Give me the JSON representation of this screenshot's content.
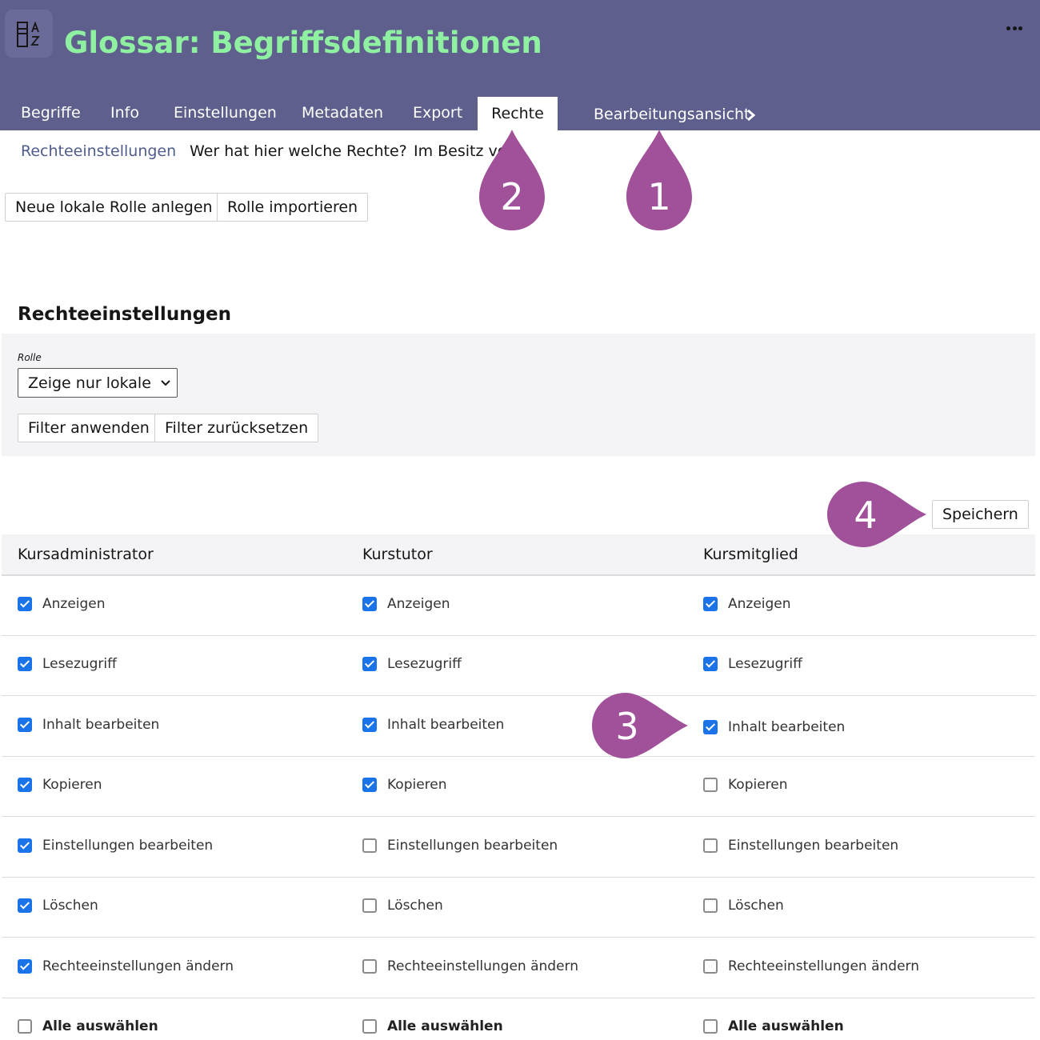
{
  "header": {
    "title": "Glossar: Begriffsdefinitionen",
    "app_icon": "glossary-az-icon",
    "more_icon": "more-dots-icon",
    "tabs": [
      "Begriffe",
      "Info",
      "Einstellungen",
      "Metadaten",
      "Export"
    ],
    "active_tab": "Rechte",
    "edit_view": "Bearbeitungsansicht"
  },
  "subtabs": {
    "active": "Rechteeinstellungen",
    "items": [
      "Wer hat hier welche Rechte?",
      "Im Besitz vo"
    ]
  },
  "actions": {
    "new_role": "Neue lokale Rolle anlegen",
    "import_role": "Rolle importieren"
  },
  "section": {
    "title": "Rechteeinstellungen",
    "filter": {
      "label": "Rolle",
      "select_value": "Zeige nur lokale Rollen",
      "apply": "Filter anwenden",
      "reset": "Filter zurücksetzen"
    },
    "save": "Speichern"
  },
  "table": {
    "columns": [
      "Kursadministrator",
      "Kurstutor",
      "Kursmitglied"
    ],
    "rows": [
      {
        "label": "Anzeigen",
        "checked": [
          true,
          true,
          true
        ]
      },
      {
        "label": "Lesezugriff",
        "checked": [
          true,
          true,
          true
        ]
      },
      {
        "label": "Inhalt bearbeiten",
        "checked": [
          true,
          true,
          true
        ]
      },
      {
        "label": "Kopieren",
        "checked": [
          true,
          true,
          false
        ]
      },
      {
        "label": "Einstellungen bearbeiten",
        "checked": [
          true,
          false,
          false
        ]
      },
      {
        "label": "Löschen",
        "checked": [
          true,
          false,
          false
        ]
      },
      {
        "label": "Rechteeinstellungen ändern",
        "checked": [
          true,
          false,
          false
        ]
      }
    ],
    "select_all": "Alle auswählen"
  },
  "markers": [
    "1",
    "2",
    "3",
    "4"
  ],
  "colors": {
    "header_bg": "#5e5f8c",
    "title": "#8ff0a2",
    "marker": "#a0519a",
    "checkbox": "#1a73e8",
    "panel_bg": "#f4f3f6"
  }
}
